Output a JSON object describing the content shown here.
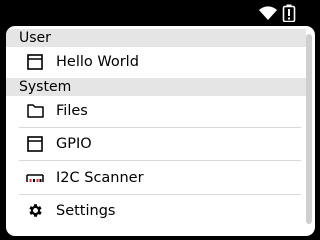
{
  "status": {
    "wifi_icon": "wifi-icon",
    "battery_icon": "battery-warning-icon"
  },
  "sections": [
    {
      "title": "User",
      "items": [
        {
          "label": "Hello World",
          "icon": "window-icon"
        }
      ]
    },
    {
      "title": "System",
      "items": [
        {
          "label": "Files",
          "icon": "folder-icon"
        },
        {
          "label": "GPIO",
          "icon": "window-icon"
        },
        {
          "label": "I2C Scanner",
          "icon": "i2c-bus-icon"
        },
        {
          "label": "Settings",
          "icon": "gear-icon"
        }
      ]
    }
  ]
}
